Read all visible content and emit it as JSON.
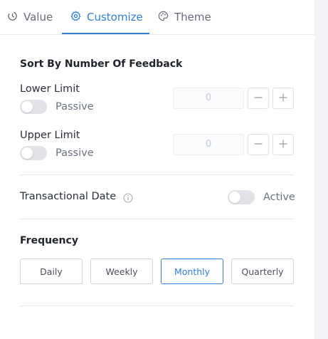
{
  "tabs": [
    {
      "label": "Value",
      "icon": "history-icon"
    },
    {
      "label": "Customize",
      "icon": "gear-icon",
      "active": true
    },
    {
      "label": "Theme",
      "icon": "palette-icon"
    }
  ],
  "sort": {
    "title": "Sort By Number Of Feedback",
    "lower": {
      "label": "Lower Limit",
      "toggle_label": "Passive",
      "value": "0"
    },
    "upper": {
      "label": "Upper Limit",
      "toggle_label": "Passive",
      "value": "0"
    }
  },
  "transactional": {
    "label": "Transactional Date",
    "toggle_label": "Active"
  },
  "frequency": {
    "title": "Frequency",
    "options": [
      "Daily",
      "Weekly",
      "Monthly",
      "Quarterly"
    ],
    "selected": "Monthly"
  },
  "colors": {
    "accent": "#2f7fd8",
    "toggle_off": "#e1e3e8"
  }
}
